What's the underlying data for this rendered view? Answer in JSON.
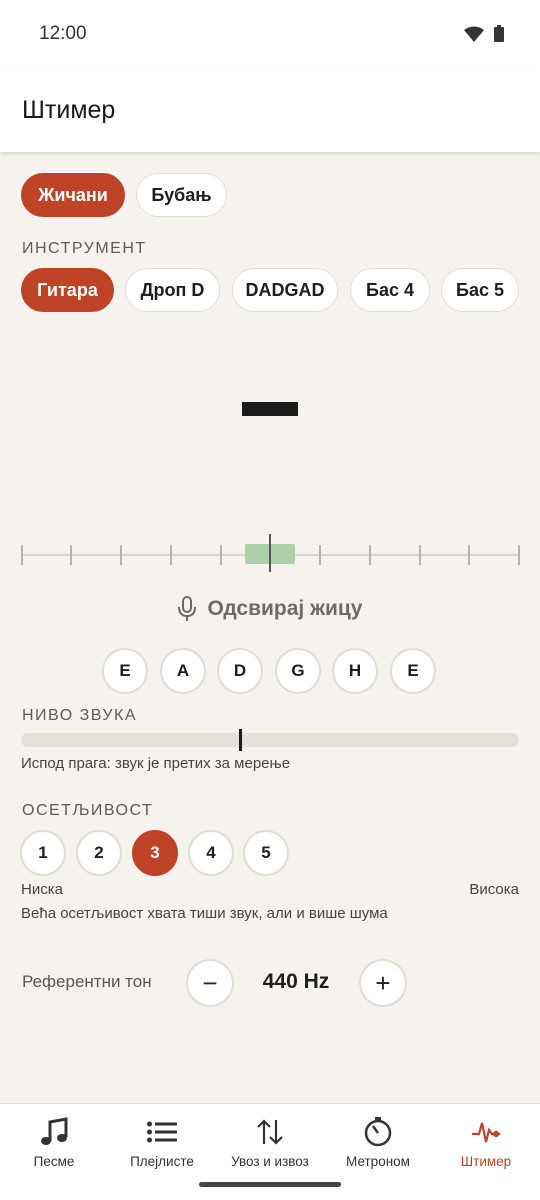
{
  "status_bar": {
    "time": "12:00"
  },
  "app_bar": {
    "title": "Штимер"
  },
  "mode_tabs": [
    {
      "label": "Жичани",
      "active": true
    },
    {
      "label": "Бубањ",
      "active": false
    }
  ],
  "instrument": {
    "section_label": "ИНСТРУМЕНТ",
    "options": [
      {
        "label": "Гитара",
        "active": true
      },
      {
        "label": "Дроп D",
        "active": false
      },
      {
        "label": "DADGAD",
        "active": false
      },
      {
        "label": "Бас 4",
        "active": false
      },
      {
        "label": "Бас 5",
        "active": false
      }
    ]
  },
  "tuner": {
    "note": "",
    "prompt": "Одсвирај жицу"
  },
  "strings": [
    "E",
    "A",
    "D",
    "G",
    "H",
    "E"
  ],
  "sound_level": {
    "section_label": "НИВО ЗВУКА",
    "threshold_fraction": 0.44,
    "status": "Испод прага: звук је претих за мерење"
  },
  "sensitivity": {
    "section_label": "ОСЕТЉИВОСТ",
    "levels": [
      "1",
      "2",
      "3",
      "4",
      "5"
    ],
    "selected": "3",
    "low_label": "Ниска",
    "high_label": "Висока",
    "hint": "Већа осетљивост хвата тиши звук, али и више шума"
  },
  "reference": {
    "label": "Референтни тон",
    "value": "440 Hz",
    "minus": "−",
    "plus": "+"
  },
  "bottom_nav": [
    {
      "label": "Песме",
      "icon": "music-note-icon",
      "active": false
    },
    {
      "label": "Плејлисте",
      "icon": "list-icon",
      "active": false
    },
    {
      "label": "Увоз и извоз",
      "icon": "import-export-icon",
      "active": false
    },
    {
      "label": "Метроном",
      "icon": "metronome-icon",
      "active": false
    },
    {
      "label": "Штимер",
      "icon": "tuner-wave-icon",
      "active": true
    }
  ],
  "colors": {
    "accent": "#bf4326",
    "background": "#f6f3ee",
    "in_tune_zone": "#a8cfa4"
  }
}
